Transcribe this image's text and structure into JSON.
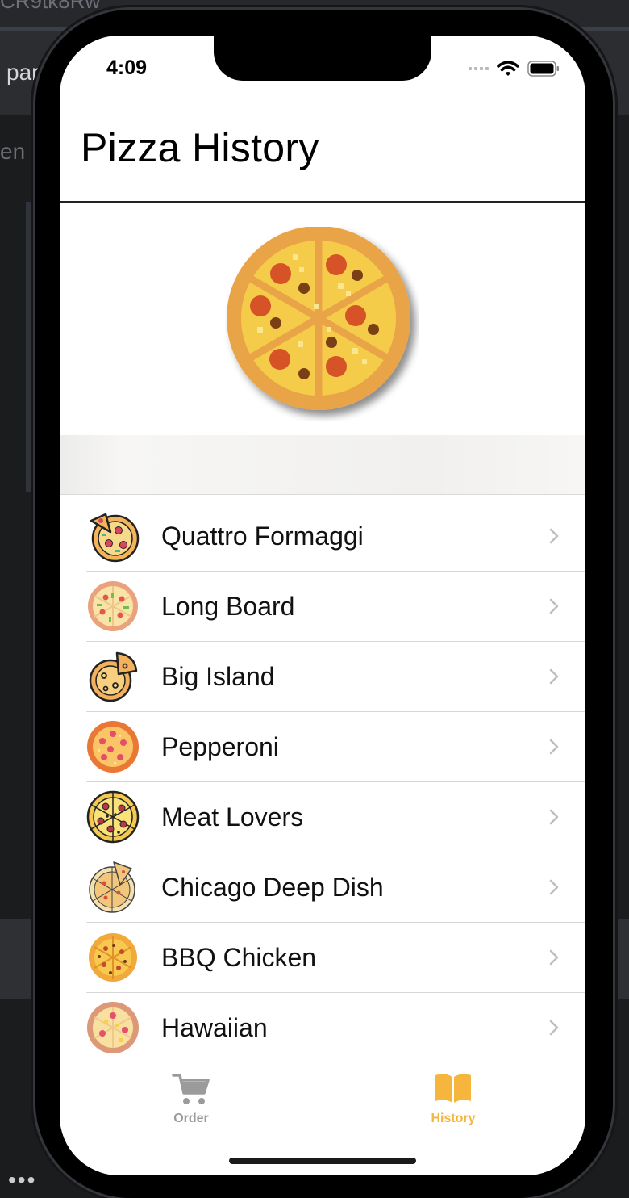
{
  "background": {
    "top_text": "CR9tk8Rw",
    "toolbar_text": "par",
    "side_text": "en",
    "bottom_text": "•••"
  },
  "status_bar": {
    "time": "4:09"
  },
  "navigation": {
    "title": "Pizza History"
  },
  "pizzas": [
    {
      "name": "Quattro Formaggi",
      "icon": "slice-pizza-icon"
    },
    {
      "name": "Long Board",
      "icon": "veggie-pizza-icon"
    },
    {
      "name": "Big Island",
      "icon": "slice-outline-pizza-icon"
    },
    {
      "name": "Pepperoni",
      "icon": "pepperoni-pizza-icon"
    },
    {
      "name": "Meat Lovers",
      "icon": "meat-pizza-icon"
    },
    {
      "name": "Chicago Deep Dish",
      "icon": "deep-dish-pizza-icon"
    },
    {
      "name": "BBQ Chicken",
      "icon": "bbq-pizza-icon"
    },
    {
      "name": "Hawaiian",
      "icon": "hawaiian-pizza-icon"
    }
  ],
  "tab_bar": {
    "tabs": [
      {
        "label": "Order",
        "icon": "cart-icon",
        "selected": false
      },
      {
        "label": "History",
        "icon": "book-icon",
        "selected": true
      }
    ],
    "colors": {
      "selected": "#f6b53c",
      "unselected": "#9b9b9b"
    }
  }
}
